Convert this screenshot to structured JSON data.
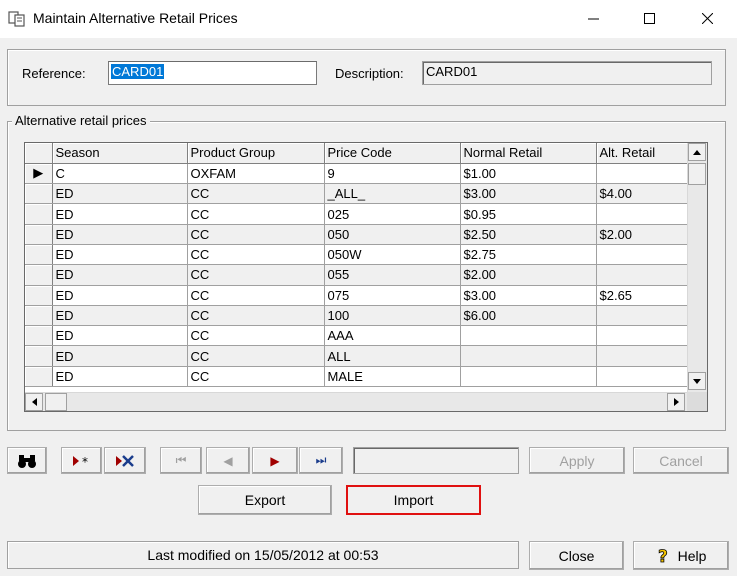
{
  "window": {
    "title": "Maintain Alternative Retail Prices",
    "minimize_glyph": "—",
    "maximize_glyph": "☐",
    "close_glyph": "✕"
  },
  "reference": {
    "label": "Reference:",
    "value": "CARD01"
  },
  "description": {
    "label": "Description:",
    "value": "CARD01"
  },
  "alt_group": {
    "title": "Alternative retail prices",
    "columns": [
      "Season",
      "Product Group",
      "Price Code",
      "Normal Retail",
      "Alt. Retail"
    ],
    "rows": [
      [
        "C",
        "OXFAM",
        "9",
        "$1.00",
        ""
      ],
      [
        "ED",
        "CC",
        "_ALL_",
        "$3.00",
        "$4.00"
      ],
      [
        "ED",
        "CC",
        "025",
        "$0.95",
        ""
      ],
      [
        "ED",
        "CC",
        "050",
        "$2.50",
        "$2.00"
      ],
      [
        "ED",
        "CC",
        "050W",
        "$2.75",
        ""
      ],
      [
        "ED",
        "CC",
        "055",
        "$2.00",
        ""
      ],
      [
        "ED",
        "CC",
        "075",
        "$3.00",
        "$2.65"
      ],
      [
        "ED",
        "CC",
        "100",
        "$6.00",
        ""
      ],
      [
        "ED",
        "CC",
        "AAA",
        "",
        ""
      ],
      [
        "ED",
        "CC",
        "ALL",
        "",
        ""
      ],
      [
        "ED",
        "CC",
        "MALE",
        "",
        ""
      ]
    ],
    "current_row_marker": "▶"
  },
  "toolbar": {
    "find_icon": "binoculars-icon",
    "insert_icon": "insert-record-icon",
    "delete_icon": "delete-record-icon",
    "first_glyph": "⏮",
    "prev_glyph": "◀",
    "next_glyph": "▶",
    "last_glyph": "⏭",
    "apply_label": "Apply",
    "cancel_label": "Cancel"
  },
  "actions": {
    "export_label": "Export",
    "import_label": "Import"
  },
  "footer": {
    "status": "Last modified on 15/05/2012 at 00:53",
    "close_label": "Close",
    "help_label": "Help"
  },
  "colors": {
    "selection": "#0078d7",
    "import_highlight": "#e01010",
    "help_icon": "#f5c400"
  }
}
